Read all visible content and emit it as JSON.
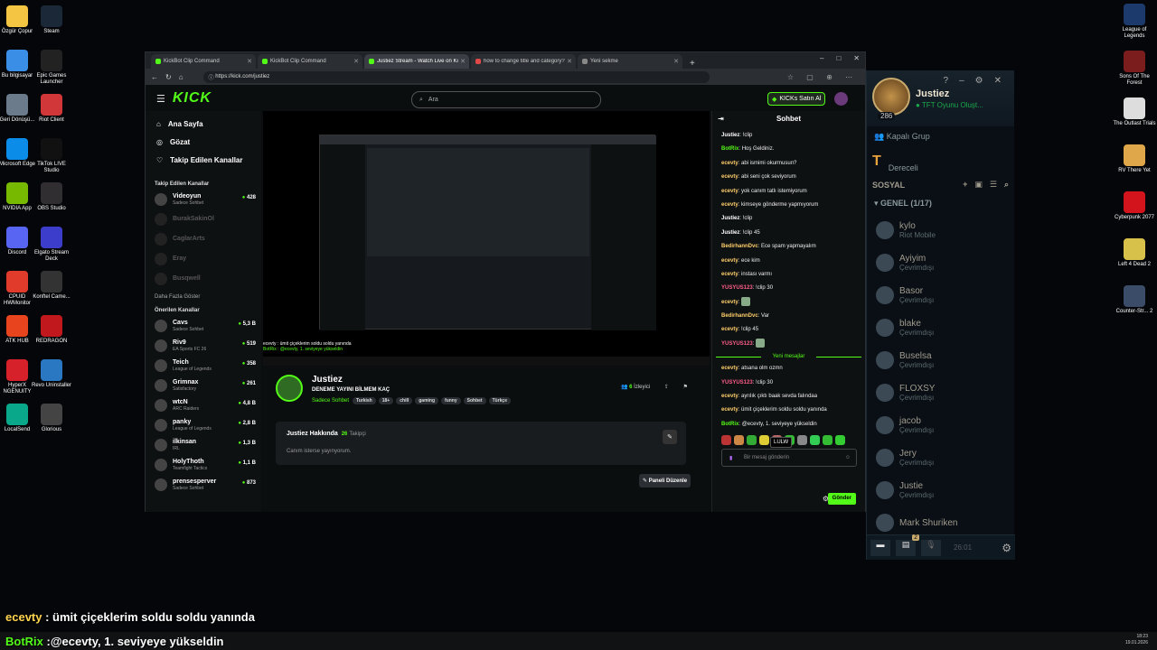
{
  "desktop_left": [
    {
      "label": "Özgür Çopur",
      "color": "#f4c542"
    },
    {
      "label": "Steam",
      "color": "#1b2838"
    },
    {
      "label": "Bu bilgisayar",
      "color": "#3a8ee6"
    },
    {
      "label": "Epic Games Launcher",
      "color": "#222"
    },
    {
      "label": "Geri Dönüşü...",
      "color": "#6b7b8c"
    },
    {
      "label": "Riot Client",
      "color": "#d13639"
    },
    {
      "label": "Microsoft Edge",
      "color": "#0c8ce9"
    },
    {
      "label": "TikTok LIVE Studio",
      "color": "#111"
    },
    {
      "label": "NVIDIA App",
      "color": "#76b900"
    },
    {
      "label": "OBS Studio",
      "color": "#302e31"
    },
    {
      "label": "Discord",
      "color": "#5865f2"
    },
    {
      "label": "Elgato Stream Deck",
      "color": "#3d3dcc"
    },
    {
      "label": "CPUID HWMonitor",
      "color": "#e03b2b"
    },
    {
      "label": "Konftel Came...",
      "color": "#333"
    },
    {
      "label": "ATK HUB",
      "color": "#e8451f"
    },
    {
      "label": "REDRAGON",
      "color": "#c0181c"
    },
    {
      "label": "HyperX NGENUITY",
      "color": "#d6202a"
    },
    {
      "label": "Revo Uninstaller",
      "color": "#2a78c2"
    },
    {
      "label": "LocalSend",
      "color": "#0aa88a"
    },
    {
      "label": "Glorious",
      "color": "#444"
    }
  ],
  "desktop_right": [
    {
      "label": "League of Legends",
      "color": "#1c3a6b"
    },
    {
      "label": "Sons Of The Forest",
      "color": "#7b1d1d"
    },
    {
      "label": "The Outlast Trials",
      "color": "#ddd"
    },
    {
      "label": "RV There Yet",
      "color": "#e0a64a"
    },
    {
      "label": "Cyberpunk 2077",
      "color": "#d4141c"
    },
    {
      "label": "Left 4 Dead 2",
      "color": "#d8c14a"
    },
    {
      "label": "Counter-Str... 2",
      "color": "#3b4c69"
    }
  ],
  "lol": {
    "name": "Justiez",
    "status": "TFT Oyunu Oluşt...",
    "level": "286",
    "group": "Kapalı Grup",
    "ranked": "Dereceli",
    "social": "SOSYAL",
    "general": "GENEL (1/17)",
    "friends": [
      {
        "name": "kylo",
        "status": "Riot Mobile"
      },
      {
        "name": "Ayiyim",
        "status": "Çevrimdışı"
      },
      {
        "name": "Basor",
        "status": "Çevrimdışı"
      },
      {
        "name": "blake",
        "status": "Çevrimdışı"
      },
      {
        "name": "Buselsa",
        "status": "Çevrimdışı"
      },
      {
        "name": "FLOXSY",
        "status": "Çevrimdışı"
      },
      {
        "name": "jacob",
        "status": "Çevrimdışı"
      },
      {
        "name": "Jery",
        "status": "Çevrimdışı"
      },
      {
        "name": "Justie",
        "status": "Çevrimdışı"
      },
      {
        "name": "Mark Shuriken",
        "status": ""
      }
    ],
    "badge": "2",
    "time": "26:01"
  },
  "browser": {
    "tabs": [
      "KickBot Clip Command",
      "KickBot Clip Command",
      "Justiez Stream - Watch Live on Kick",
      "how to change title and category?",
      "Yeni sekme"
    ],
    "url": "https://kick.com/justiez"
  },
  "kick": {
    "logo": "KICK",
    "search_placeholder": "Ara",
    "buy": "KICKs Satın Al",
    "nav": [
      {
        "label": "Ana Sayfa",
        "icon": "⌂"
      },
      {
        "label": "Gözat",
        "icon": "◎"
      },
      {
        "label": "Takip Edilen Kanallar",
        "icon": "♡"
      }
    ],
    "followed_title": "Takip Edilen Kanallar",
    "followed": [
      {
        "name": "Videoyun",
        "cat": "Sadece Sohbet",
        "viewers": "428",
        "off": false
      },
      {
        "name": "BurakSakinOl",
        "cat": "",
        "viewers": "",
        "off": true
      },
      {
        "name": "CaglarArts",
        "cat": "",
        "viewers": "",
        "off": true
      },
      {
        "name": "Eray",
        "cat": "",
        "viewers": "",
        "off": true
      },
      {
        "name": "Busqwell",
        "cat": "",
        "viewers": "",
        "off": true
      }
    ],
    "more": "Daha Fazla Göster",
    "recommended_title": "Önerilen Kanallar",
    "recommended": [
      {
        "name": "Cavs",
        "cat": "Sadece Sohbet",
        "viewers": "5,3 B"
      },
      {
        "name": "Riv9",
        "cat": "EA Sports FC 26",
        "viewers": "519"
      },
      {
        "name": "Teich",
        "cat": "League of Legends",
        "viewers": "358"
      },
      {
        "name": "Grimnax",
        "cat": "Satisfactory",
        "viewers": "261"
      },
      {
        "name": "wtcN",
        "cat": "ARC Raiders",
        "viewers": "4,8 B"
      },
      {
        "name": "panky",
        "cat": "League of Legends",
        "viewers": "2,8 B"
      },
      {
        "name": "ilkinsan",
        "cat": "IRL",
        "viewers": "1,3 B"
      },
      {
        "name": "HolyThoth",
        "cat": "Teamfight Tactics",
        "viewers": "1,1 B"
      },
      {
        "name": "prensesperver",
        "cat": "Sadece Sohbet",
        "viewers": "873"
      }
    ],
    "stream_caption1": "ecevty : ümit çiçeklerim soldu soldu yanında",
    "stream_caption2": "BotRix : @ecevty, 1. seviyeye yükseldin",
    "streamer": "Justiez",
    "title": "DENEME YAYINI BİLMEM KAÇ",
    "category": "Sadece Sohbet",
    "tags": [
      "Turkish",
      "18+",
      "chill",
      "gaming",
      "funny",
      "Sohbet",
      "Türkçe"
    ],
    "viewers_count": "6",
    "viewers_label": "İzleyici",
    "about_title": "Justiez Hakkında",
    "followers_count": "26",
    "followers_label": "Takipçi",
    "about_desc": "Canım isterse yayınyorum.",
    "panel_btn": "Paneli Düzenle"
  },
  "chat": {
    "title": "Sohbet",
    "messages": [
      {
        "user": "Justiez",
        "color": "#ffffff",
        "text": "!clip"
      },
      {
        "user": "BotRix",
        "color": "#53fc18",
        "text": "Hoş Geldiniz."
      },
      {
        "user": "ecevty",
        "color": "#ffcf6b",
        "text": "abi ismimi okurmusun?"
      },
      {
        "user": "ecevty",
        "color": "#ffcf6b",
        "text": "abi seni çok seviyorum"
      },
      {
        "user": "ecevty",
        "color": "#ffcf6b",
        "text": "yok canım tatlı istemiyorum"
      },
      {
        "user": "ecevty",
        "color": "#ffcf6b",
        "text": "kimseye gönderme yapmıyorum"
      },
      {
        "user": "Justiez",
        "color": "#ffffff",
        "text": "!clip"
      },
      {
        "user": "Justiez",
        "color": "#ffffff",
        "text": "!clip 45"
      },
      {
        "user": "BedirhannDvc",
        "color": "#ffcf6b",
        "text": "Ece spam yapmayalım"
      },
      {
        "user": "ecevty",
        "color": "#ffcf6b",
        "text": "ece kim"
      },
      {
        "user": "ecevty",
        "color": "#ffcf6b",
        "text": "instası varmı"
      },
      {
        "user": "YUSYUS123",
        "color": "#ff5d8a",
        "text": "!clip 30"
      },
      {
        "user": "ecevty",
        "color": "#ffcf6b",
        "text": ""
      },
      {
        "user": "BedirhannDvc",
        "color": "#ffcf6b",
        "text": "Var"
      },
      {
        "user": "ecevty",
        "color": "#ffcf6b",
        "text": "!clip 45"
      },
      {
        "user": "YUSYUS123",
        "color": "#ff5d8a",
        "text": ""
      }
    ],
    "new_label": "Yeni mesajlar",
    "new_messages": [
      {
        "user": "ecevty",
        "color": "#ffcf6b",
        "text": "atsana olm ozmn"
      },
      {
        "user": "YUSYUS123",
        "color": "#ff5d8a",
        "text": "!clip 30"
      },
      {
        "user": "ecevty",
        "color": "#ffcf6b",
        "text": "ayrılık çıktı baak sevda falındaa"
      },
      {
        "user": "ecevty",
        "color": "#ffcf6b",
        "text": "ümit çiçeklerim soldu soldu yanında"
      },
      {
        "user": "BotRix",
        "color": "#53fc18",
        "text": "@ecevty, 1. seviyeye yükseldin"
      }
    ],
    "tooltip": "LULW",
    "placeholder": "Bir mesaj gönderin",
    "send": "Gönder"
  },
  "overlay": {
    "line1_user": "ecevty",
    "line1_text": " : ümit çiçeklerim soldu soldu yanında",
    "line2_user": "BotRix",
    "line2_text": " :@ecevty, 1. seviyeye yükseldin"
  },
  "tray": {
    "time": "18:23",
    "date": "19.01.2026"
  }
}
